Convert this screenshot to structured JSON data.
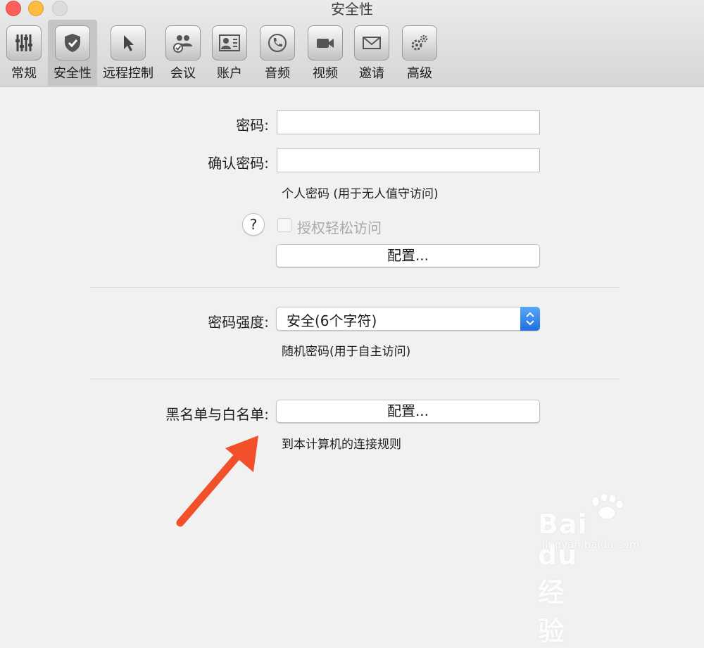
{
  "window": {
    "title": "安全性"
  },
  "toolbar": {
    "tabs": [
      {
        "label": "常规",
        "icon": "sliders-icon"
      },
      {
        "label": "安全性",
        "icon": "shield-icon",
        "active": true
      },
      {
        "label": "远程控制",
        "icon": "cursor-icon"
      },
      {
        "label": "会议",
        "icon": "meeting-icon"
      },
      {
        "label": "账户",
        "icon": "contact-card-icon"
      },
      {
        "label": "音频",
        "icon": "phone-icon"
      },
      {
        "label": "视频",
        "icon": "video-camera-icon"
      },
      {
        "label": "邀请",
        "icon": "envelope-icon"
      },
      {
        "label": "高级",
        "icon": "gears-icon"
      }
    ]
  },
  "personal": {
    "password_label": "密码:",
    "password_value": "",
    "confirm_label": "确认密码:",
    "confirm_value": "",
    "hint": "个人密码 (用于无人值守访问)",
    "easy_access_label": "授权轻松访问",
    "easy_access_checked": false,
    "help_label": "?",
    "config_button": "配置..."
  },
  "random": {
    "strength_label": "密码强度:",
    "strength_value": "安全(6个字符)",
    "hint": "随机密码(用于自主访问)"
  },
  "lists": {
    "label": "黑名单与白名单:",
    "config_button": "配置...",
    "hint": "到本计算机的连接规则"
  },
  "annotation": {
    "arrow_color": "#f2502a"
  },
  "watermark": {
    "brand": "Bai du 经验",
    "url": "jingyan.baidu.com"
  }
}
